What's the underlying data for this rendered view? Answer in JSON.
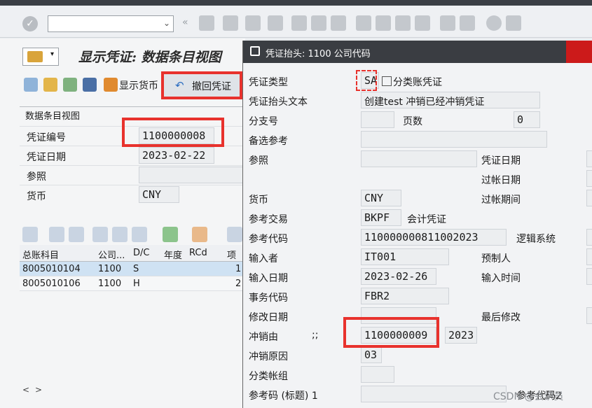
{
  "left": {
    "title": "显示凭证: 数据条目视图",
    "toolbar": {
      "display_currency": "显示货币",
      "reverse_doc": "撤回凭证"
    },
    "entry_view": {
      "section_title": "数据条目视图",
      "fields": [
        {
          "label": "凭证编号",
          "value": "1100000008"
        },
        {
          "label": "凭证日期",
          "value": "2023-02-22"
        },
        {
          "label": "参照",
          "value": ""
        },
        {
          "label": "货币",
          "value": "CNY"
        }
      ]
    },
    "grid": {
      "headers": [
        "总账科目",
        "公司...",
        "D/C",
        "年度",
        "RCd",
        "项"
      ],
      "rows": [
        {
          "gl": "8005010104",
          "company": "1100",
          "dc": "S",
          "item": "1"
        },
        {
          "gl": "8005010106",
          "company": "1100",
          "dc": "H",
          "item": "2"
        }
      ],
      "scroll_left": "<",
      "scroll_right": ">"
    }
  },
  "dialog": {
    "title": "凭证抬头: 1100 公司代码",
    "fields": {
      "doc_type_label": "凭证类型",
      "doc_type_value": "SA",
      "doc_type_desc": "分类账凭证",
      "header_text_label": "凭证抬头文本",
      "header_text_value": "创建test 冲销已经冲销凭证",
      "branch_label": "分支号",
      "pages_label": "页数",
      "pages_value": "0",
      "alt_ref_label": "备选参考",
      "ref_label": "参照",
      "doc_date_label": "凭证日期",
      "posting_date_label": "过帐日期",
      "currency_label": "货币",
      "currency_value": "CNY",
      "posting_period_label": "过帐期间",
      "ref_trans_label": "参考交易",
      "ref_trans_value": "BKPF",
      "ref_trans_desc": "会计凭证",
      "ref_key_label": "参考代码",
      "ref_key_value": "110000000811002023",
      "logical_system_label": "逻辑系统",
      "entered_by_label": "输入者",
      "entered_by_value": "IT001",
      "parked_by_label": "预制人",
      "entry_date_label": "输入日期",
      "entry_date_value": "2023-02-26",
      "entry_time_label": "输入时间",
      "tcode_label": "事务代码",
      "tcode_value": "FBR2",
      "changed_on_label": "修改日期",
      "last_changed_label": "最后修改",
      "reversed_by_label": "冲销由",
      "reversed_by_sep": ";;",
      "reversed_by_value": "1100000009",
      "reversed_by_year": "2023",
      "reversal_reason_label": "冲销原因",
      "reversal_reason_value": "03",
      "ledger_group_label": "分类帐组",
      "ref_key_head_label": "参考码 (标题) 1",
      "ref_key_2_label": "参考代码2"
    }
  },
  "watermark": "CSDN @会识员",
  "colors": {
    "highlight_red": "#e8322d",
    "dialog_title": "#3a3d42",
    "close_red": "#cc1a1a",
    "selected_row": "#cfe2f3"
  }
}
